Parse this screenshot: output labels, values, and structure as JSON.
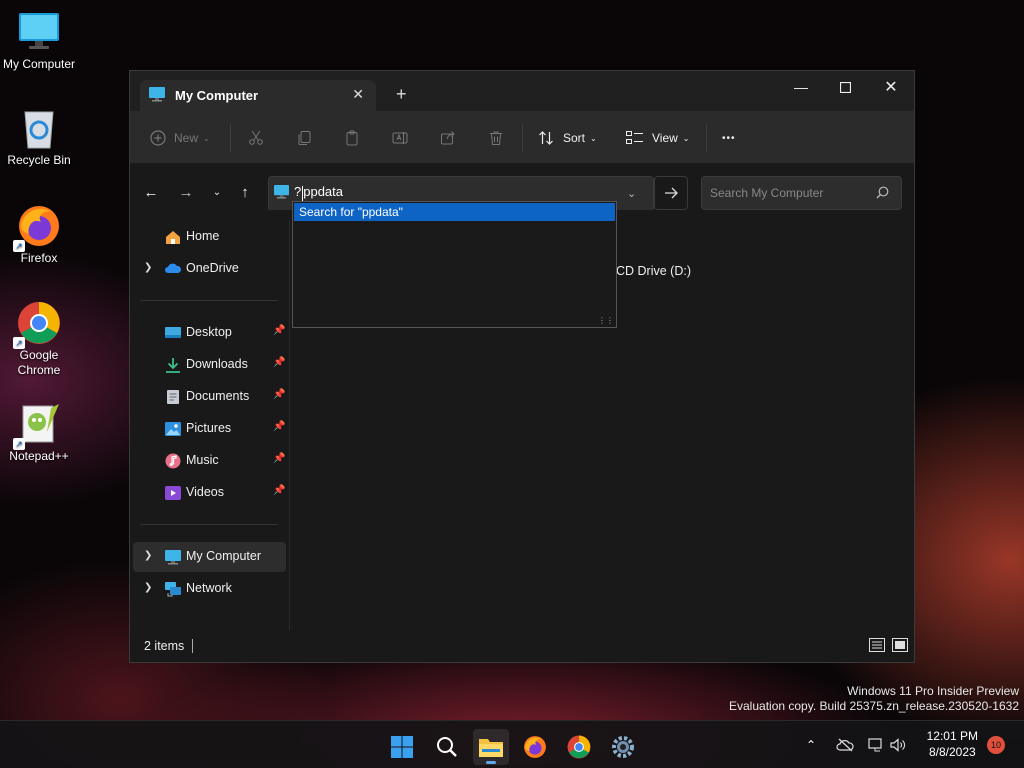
{
  "desktop": {
    "icons": [
      {
        "label": "My Computer"
      },
      {
        "label": "Recycle Bin"
      },
      {
        "label": "Firefox"
      },
      {
        "label": "Google Chrome"
      },
      {
        "label": "Notepad++"
      }
    ],
    "watermark": {
      "line1": "Windows 11 Pro Insider Preview",
      "line2": "Evaluation copy. Build 25375.zn_release.230520-1632"
    }
  },
  "window": {
    "tab_title": "My Computer",
    "toolbar": {
      "new_label": "New",
      "sort_label": "Sort",
      "view_label": "View",
      "more_label": "•••"
    },
    "address": {
      "prefix": "?",
      "typed_before_caret": "p",
      "typed_after_caret": "pdata",
      "suggestion": "Search for \"ppdata\""
    },
    "search": {
      "placeholder": "Search My Computer"
    },
    "sidebar": {
      "items": [
        {
          "label": "Home"
        },
        {
          "label": "OneDrive"
        },
        {
          "label": "Desktop"
        },
        {
          "label": "Downloads"
        },
        {
          "label": "Documents"
        },
        {
          "label": "Pictures"
        },
        {
          "label": "Music"
        },
        {
          "label": "Videos"
        },
        {
          "label": "My Computer"
        },
        {
          "label": "Network"
        }
      ]
    },
    "content": {
      "partial_drive_label": "CD Drive (D:)"
    },
    "status": {
      "items_count": "2 items"
    }
  },
  "taskbar": {
    "time": "12:01 PM",
    "date": "8/8/2023",
    "notification_count": "10"
  },
  "colors": {
    "accent": "#0e64c4",
    "window_bg": "#191919",
    "toolbar_bg": "#2b2b2b"
  }
}
